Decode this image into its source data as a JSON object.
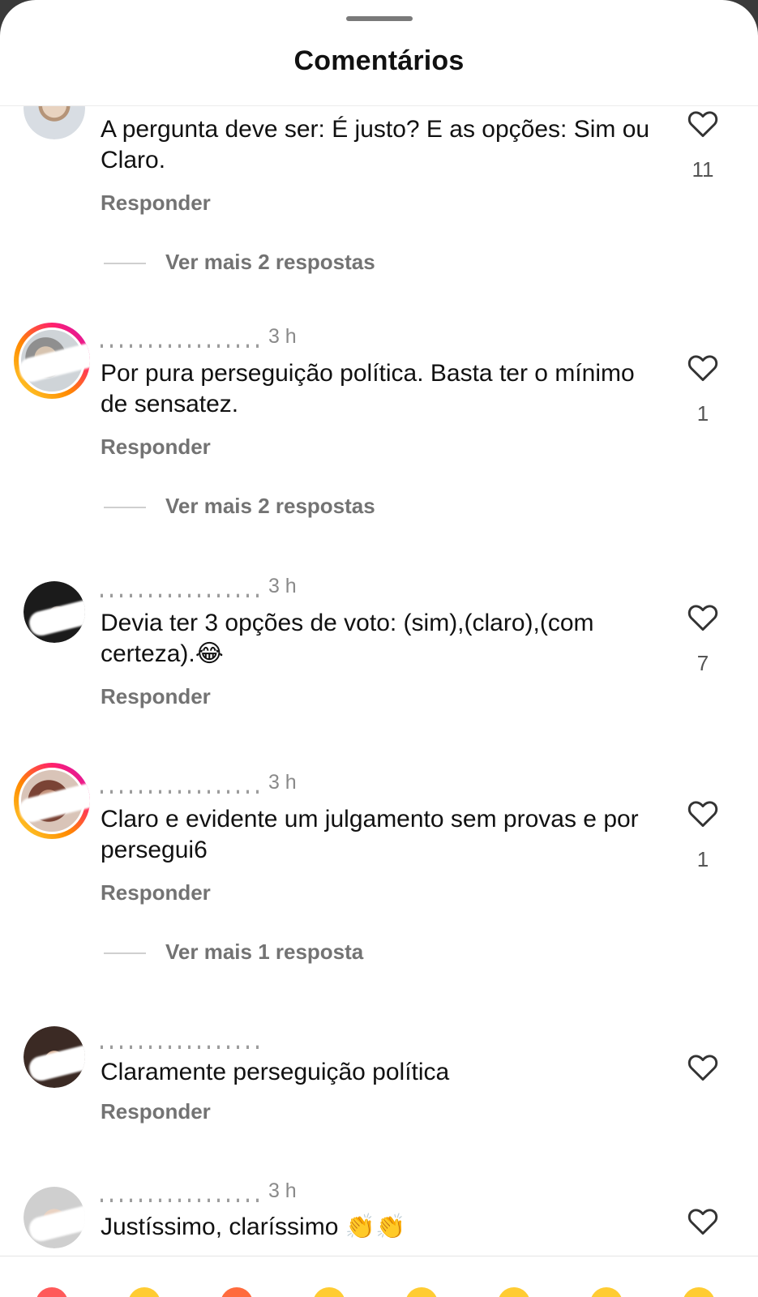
{
  "sheet": {
    "title": "Comentários"
  },
  "labels": {
    "reply": "Responder"
  },
  "comments": [
    {
      "time": "",
      "text": "A pergunta deve ser: É justo? E as opções: Sim ou Claro.",
      "likes": "11",
      "more_replies": "Ver mais 2 respostas"
    },
    {
      "time": "3 h",
      "text": "Por pura perseguição política. Basta ter o mínimo de sensatez.",
      "likes": "1",
      "more_replies": "Ver mais 2 respostas"
    },
    {
      "time": "3 h",
      "text": "Devia ter 3 opções de voto: (sim),(claro),(com certeza).",
      "emoji": "😂",
      "likes": "7",
      "more_replies": ""
    },
    {
      "time": "3 h",
      "text": "Claro e evidente um julgamento sem provas e por persegui6",
      "likes": "1",
      "more_replies": "Ver mais 1 resposta"
    },
    {
      "time": "",
      "text": "Claramente perseguição política",
      "likes": "",
      "more_replies": ""
    },
    {
      "time": "3 h",
      "text": "Justíssimo, claríssimo",
      "emoji": "👏👏",
      "likes": "",
      "more_replies": ""
    }
  ],
  "colors": {
    "story_ring": [
      "#fdd835",
      "#ff8a00",
      "#ff1f6e",
      "#c013c9"
    ],
    "secondary_text": "#737373"
  },
  "icons": {
    "like": "heart-outline-icon"
  }
}
